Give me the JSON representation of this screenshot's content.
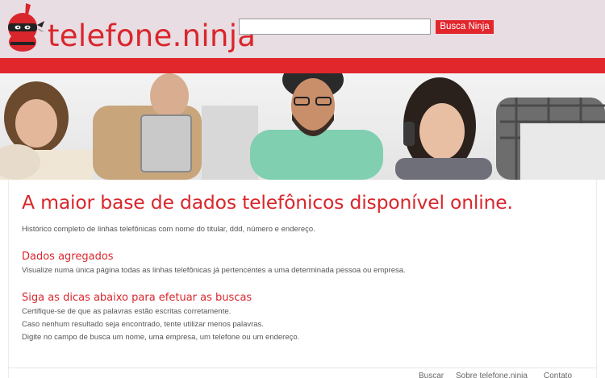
{
  "header": {
    "logo_text": "telefone.ninja",
    "search": {
      "value": "",
      "placeholder": ""
    },
    "search_button": "Busca Ninja"
  },
  "main": {
    "headline": "A maior base de dados telefônicos disponível online.",
    "intro": "Histórico completo de linhas telefônicas com nome do titular, ddd, número e endereço.",
    "section1": {
      "title": "Dados agregados",
      "text": "Visualize numa única página todas as linhas telefônicas já pertencentes a uma determinada pessoa ou empresa."
    },
    "section2": {
      "title": "Siga as dicas abaixo para efetuar as buscas",
      "tips": [
        "Certifique-se de que as palavras estão escritas corretamente.",
        "Caso nenhum resultado seja encontrado, tente utilizar menos palavras.",
        "Digite no campo de busca um nome, uma empresa, um telefone ou um endereço."
      ]
    }
  },
  "footer": {
    "links": [
      "Buscar",
      "Sobre telefone.ninja",
      "Contato"
    ]
  },
  "colors": {
    "brand_red": "#e1262c",
    "header_bg": "#e8dde2"
  },
  "icons": {
    "logo": "ninja-mascot-icon"
  }
}
